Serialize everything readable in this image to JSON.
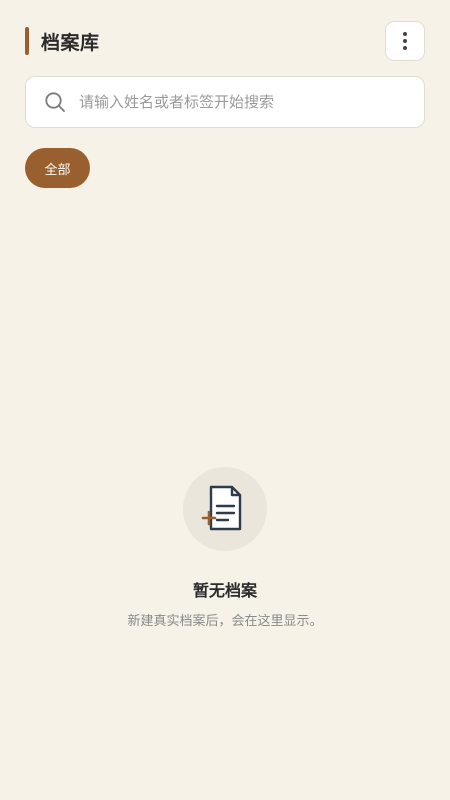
{
  "header": {
    "title": "档案库",
    "more_icon": "more-vertical-icon"
  },
  "search": {
    "placeholder": "请输入姓名或者标签开始搜索",
    "value": "",
    "icon": "search-icon"
  },
  "filters": {
    "active": "全部",
    "items": [
      {
        "label": "全部"
      }
    ]
  },
  "empty_state": {
    "icon": "add-document-icon",
    "title": "暂无档案",
    "description": "新建真实档案后，会在这里显示。"
  },
  "colors": {
    "background": "#f7f2e8",
    "accent": "#9a5f2e",
    "card": "#ffffff",
    "icon_dark": "#2f3a4a"
  }
}
